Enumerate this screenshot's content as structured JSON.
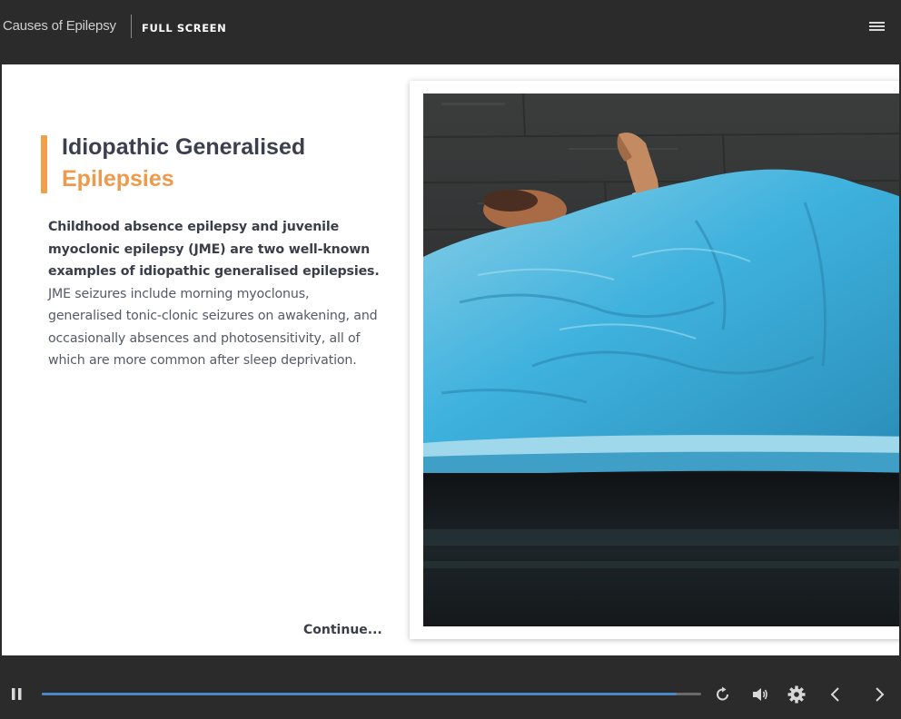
{
  "header": {
    "course_title": "Causes of Epilepsy",
    "fullscreen_label": "FULL SCREEN",
    "menu_icon": "hamburger-menu-icon"
  },
  "slide": {
    "heading_line1": "Idiopathic Generalised",
    "heading_line2": "Epilepsies",
    "body_bold": "Childhood absence epilepsy and juvenile myoclonic epilepsy (JME) are two well-known examples of idiopathic generalised epilepsies.",
    "body_regular": " JME seizures include morning myoclonus, generalised tonic-clonic seizures on awakening, and occasionally absences and photosensitivity, all of which are more common after sleep deprivation.",
    "continue_label": "Continue...",
    "video_description_icon": "video-player"
  },
  "controls": {
    "pause_icon": "pause-icon",
    "progress_fraction": 0.963,
    "replay_icon": "replay-icon",
    "volume_icon": "volume-icon",
    "settings_icon": "gear-icon",
    "prev_icon": "chevron-left-icon",
    "next_icon": "chevron-right-icon"
  },
  "colors": {
    "accent": "#f0a04b",
    "heading": "#3c3f4e",
    "progress": "#4e86c8",
    "chrome": "#2b2b2c"
  }
}
